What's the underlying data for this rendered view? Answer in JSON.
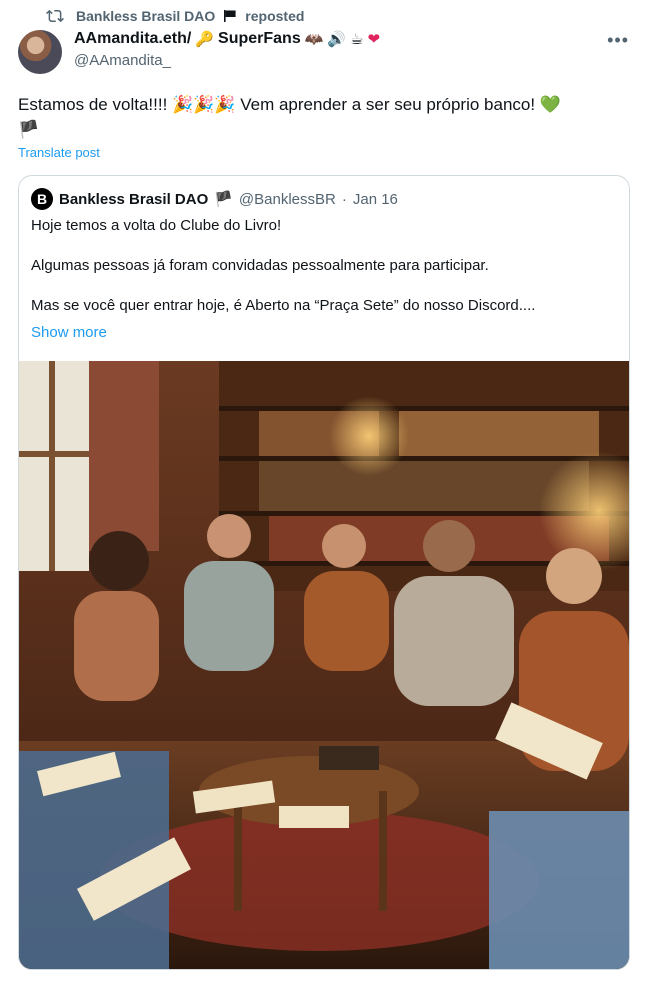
{
  "repost": {
    "account": "Bankless Brasil DAO",
    "flag_icon": "black-flag-icon",
    "label": "reposted"
  },
  "author": {
    "name": "AAmandita.eth/",
    "superfans": "SuperFans",
    "handle": "@AAmandita_",
    "name_emojis": [
      "🔑",
      "🦇",
      "🔊",
      "☕",
      "❤"
    ]
  },
  "tweet": {
    "text": "Estamos de volta!!!! 🎉🎉🎉 Vem aprender a ser seu próprio banco! 💚",
    "trailing_flag": "🏴",
    "translate": "Translate post"
  },
  "quote": {
    "avatar_letter": "B",
    "name": "Bankless Brasil DAO",
    "flag": "🏴",
    "handle": "@BanklessBR",
    "separator": "·",
    "date": "Jan 16",
    "paragraphs": [
      "Hoje temos a volta do Clube do Livro!",
      "Algumas pessoas já foram convidadas pessoalmente para participar.",
      "Mas se você quer entrar hoje, é Aberto na “Praça Sete” do nosso Discord...."
    ],
    "show_more": "Show more"
  },
  "colors": {
    "link": "#1d9bf0",
    "secondary_text": "#536471",
    "border": "#cfd9de"
  }
}
